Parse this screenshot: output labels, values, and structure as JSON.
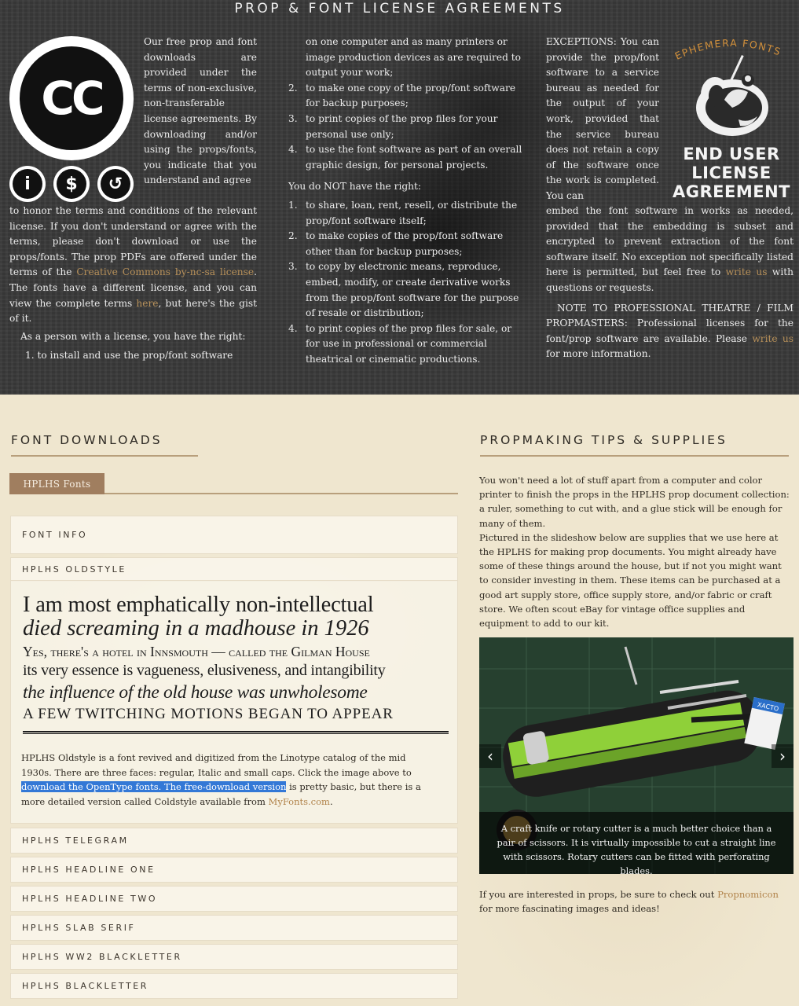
{
  "license": {
    "title": "PROP & FONT LICENSE AGREEMENTS",
    "cc_logo_text": "CC",
    "cc_icons": [
      {
        "name": "attribution-icon",
        "glyph": "i"
      },
      {
        "name": "noncommercial-icon",
        "glyph": "$"
      },
      {
        "name": "sharealike-icon",
        "glyph": "↺"
      }
    ],
    "col1_a": "Our free prop and font downloads are provided under the terms of non-exclusive, non-transferable license agreements. By downloading and/or using the props/fonts, you indicate that you understand and agree",
    "col1_b_pre": "to honor the terms and conditions of the relevant license. If you don't understand or agree with the terms, please don't download or use the props/fonts. The prop PDFs are offered under the terms of the ",
    "col1_b_link": "Creative Commons by-nc-sa license",
    "col1_b_mid": ". The fonts have a different license, and you can view the complete terms ",
    "col1_b_link2": "here",
    "col1_b_post": ", but here's the gist of it.",
    "col1_c": "As a person with a license, you have the right:",
    "col1_item1": "1. to install and use the prop/font software",
    "col2_intro": "on one computer and as many printers or image production devices as are required to output your work;",
    "col2_rights": [
      {
        "n": "2.",
        "t": "to make one copy of the prop/font software for backup purposes;"
      },
      {
        "n": "3.",
        "t": "to print copies of the prop files for your personal use only;"
      },
      {
        "n": "4.",
        "t": "to use the font software as part of an overall graphic design, for personal projects."
      }
    ],
    "col2_not": "You do NOT have the right:",
    "col2_not_items": [
      {
        "n": "1.",
        "t": "to share, loan, rent, resell, or distribute the prop/font software itself;"
      },
      {
        "n": "2.",
        "t": "to make copies of the prop/font software other than for backup purposes;"
      },
      {
        "n": "3.",
        "t": "to copy by electronic means, reproduce, embed, modify, or create derivative works from the prop/font software for the purpose of resale or distribution;"
      },
      {
        "n": "4.",
        "t": "to print copies of the prop files for sale, or for use in professional or commercial theatrical or cinematic productions."
      }
    ],
    "col3_a": "EXCEPTIONS: You can provide the prop/font software to a service bureau as needed for the output of your work, provided that the service bureau does not retain a copy of the software once the work is completed. You can",
    "col3_b_pre": "embed the font software in works as needed, provided that the embedding is subset and encrypted to prevent extraction of the font software itself. No exception not specifically listed here is permitted, but feel free to ",
    "col3_b_link": "write us",
    "col3_b_post": " with questions or requests.",
    "col3_c": "NOTE TO PROFESSIONAL THEATRE / FILM PROPMASTERS: Professional licenses for the font/prop software are available. Please ",
    "col3_c_link": "write us",
    "col3_c_post": " for more information.",
    "ephemera_logo": "EPHEMERA FONTS",
    "eula": [
      "END USER",
      "LICENSE",
      "AGREEMENT"
    ]
  },
  "font_downloads": {
    "heading": "FONT DOWNLOADS",
    "tab": "HPLHS Fonts",
    "items": [
      "FONT INFO",
      "HPLHS OLDSTYLE",
      "HPLHS TELEGRAM",
      "HPLHS HEADLINE ONE",
      "HPLHS HEADLINE TWO",
      "HPLHS SLAB SERIF",
      "HPLHS WW2 BLACKLETTER",
      "HPLHS BLACKLETTER"
    ],
    "specimen": [
      "I am most emphatically non-intellectual",
      "died screaming in a madhouse in 1926",
      "Yes, there's a hotel in Innsmouth — called the Gilman House",
      "its very essence is vagueness, elusiveness, and intangibility",
      "the influence of the old house was unwholesome",
      "A FEW TWITCHING MOTIONS BEGAN TO APPEAR"
    ],
    "desc_pre": "HPLHS Oldstyle is a font revived and digitized from the Linotype catalog of the mid 1930s. There are three faces: regular, Italic and small caps. Click the image above to ",
    "desc_highlight": "download the OpenType fonts. The free-download version",
    "desc_mid": " is pretty basic, but there is a more detailed version called Coldstyle available from ",
    "desc_link": "MyFonts.com",
    "desc_post": "."
  },
  "propmaking": {
    "heading": "PROPMAKING TIPS & SUPPLIES",
    "para1": "You won't need a lot of stuff apart from a computer and color printer to finish the props in the HPLHS prop document collection: a ruler, something to cut with, and a glue stick will be enough for many of them.",
    "para2": "Pictured in the slideshow below are supplies that we use here at the HPLHS for making prop documents. You might already have some of these things around the house, but if not you might want to consider investing in them. These items can be purchased at a good art supply store, office supply store, and/or fabric or craft store. We often scout eBay for vintage office supplies and equipment to add to our kit.",
    "caption": "A craft knife or rotary cutter is a much better choice than a pair of scissors. It is virtually impossible to cut a straight line with scissors. Rotary cutters can be fitted with perforating blades.",
    "prev": "‹",
    "next": "›",
    "box_label": "XACTO",
    "footer_pre": "If you are interested in props, be sure to check out ",
    "footer_link": "Propnomicon",
    "footer_post": " for more fascinating images and ideas!"
  },
  "colors": {
    "accent": "#a07e5f",
    "link": "#b1834a",
    "highlight": "#3378d6",
    "dark_band": "#3a3a3a",
    "paper": "#efe6cf"
  }
}
